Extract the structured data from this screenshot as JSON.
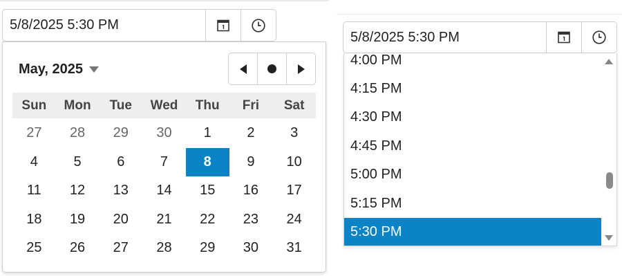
{
  "left_picker": {
    "value": "5/8/2025 5:30 PM",
    "calendar": {
      "title": "May, 2025",
      "weekdays": [
        "Sun",
        "Mon",
        "Tue",
        "Wed",
        "Thu",
        "Fri",
        "Sat"
      ],
      "weeks": [
        [
          "27",
          "28",
          "29",
          "30",
          "1",
          "2",
          "3"
        ],
        [
          "4",
          "5",
          "6",
          "7",
          "8",
          "9",
          "10"
        ],
        [
          "11",
          "12",
          "13",
          "14",
          "15",
          "16",
          "17"
        ],
        [
          "18",
          "19",
          "20",
          "21",
          "22",
          "23",
          "24"
        ],
        [
          "25",
          "26",
          "27",
          "28",
          "29",
          "30",
          "31"
        ]
      ],
      "other_month_cells": [
        "0-0",
        "0-1",
        "0-2",
        "0-3"
      ],
      "selected_cell": "1-4"
    }
  },
  "right_picker": {
    "value": "5/8/2025 5:30 PM",
    "time_options": [
      "4:00 PM",
      "4:15 PM",
      "4:30 PM",
      "4:45 PM",
      "5:00 PM",
      "5:15 PM",
      "5:30 PM"
    ],
    "selected_index": 6
  },
  "icons": {
    "calendar": "calendar-icon",
    "clock": "clock-icon",
    "prev": "triangle-left-icon",
    "today": "dot-icon",
    "next": "triangle-right-icon",
    "title_caret": "caret-down-icon"
  },
  "colors": {
    "accent": "#0a84c6",
    "weekday_header_bg": "#eeeeee",
    "border": "#cfcfcf"
  }
}
